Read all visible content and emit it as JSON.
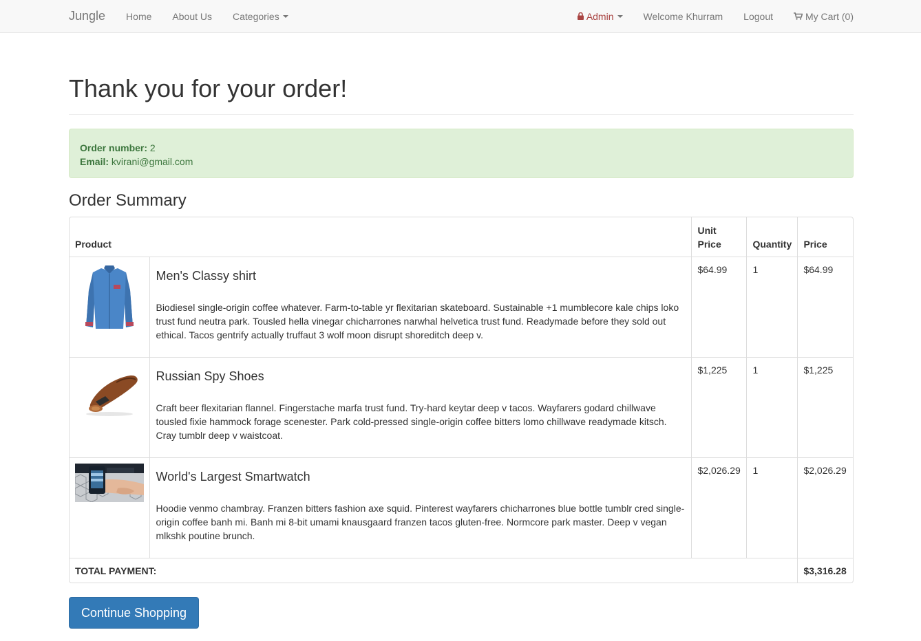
{
  "nav": {
    "brand": "Jungle",
    "home": "Home",
    "about": "About Us",
    "categories": "Categories",
    "admin": "Admin",
    "welcome": "Welcome Khurram",
    "logout": "Logout",
    "cart": "My Cart (0)",
    "admin_color": "#a94442"
  },
  "page": {
    "title": "Thank you for your order!"
  },
  "order": {
    "number_label": "Order number:",
    "number": "2",
    "email_label": "Email:",
    "email": "kvirani@gmail.com"
  },
  "summary": {
    "title": "Order Summary",
    "headers": {
      "product": "Product",
      "unit_price_1": "Unit",
      "unit_price_2": "Price",
      "quantity": "Quantity",
      "price": "Price"
    },
    "items": [
      {
        "name": "Men's Classy shirt",
        "description": "Biodiesel single-origin coffee whatever. Farm-to-table yr flexitarian skateboard. Sustainable +1 mumblecore kale chips loko trust fund neutra park. Tousled hella vinegar chicharrones narwhal helvetica trust fund. Readymade before they sold out ethical. Tacos gentrify actually truffaut 3 wolf moon disrupt shoreditch deep v.",
        "unit_price": "$64.99",
        "quantity": "1",
        "price": "$64.99",
        "image": "shirt-image"
      },
      {
        "name": "Russian Spy Shoes",
        "description": "Craft beer flexitarian flannel. Fingerstache marfa trust fund. Try-hard keytar deep v tacos. Wayfarers godard chillwave tousled fixie hammock forage scenester. Park cold-pressed single-origin coffee bitters lomo chillwave readymade kitsch. Cray tumblr deep v waistcoat.",
        "unit_price": "$1,225",
        "quantity": "1",
        "price": "$1,225",
        "image": "shoe-image"
      },
      {
        "name": "World's Largest Smartwatch",
        "description": "Hoodie venmo chambray. Franzen bitters fashion axe squid. Pinterest wayfarers chicharrones blue bottle tumblr cred single-origin coffee banh mi. Banh mi 8-bit umami knausgaard franzen tacos gluten-free. Normcore park master. Deep v vegan mlkshk poutine brunch.",
        "unit_price": "$2,026.29",
        "quantity": "1",
        "price": "$2,026.29",
        "image": "smartwatch-image"
      }
    ],
    "total_label": "TOTAL PAYMENT:",
    "total": "$3,316.28"
  },
  "actions": {
    "continue": "Continue Shopping",
    "button_color": "#337ab7"
  }
}
